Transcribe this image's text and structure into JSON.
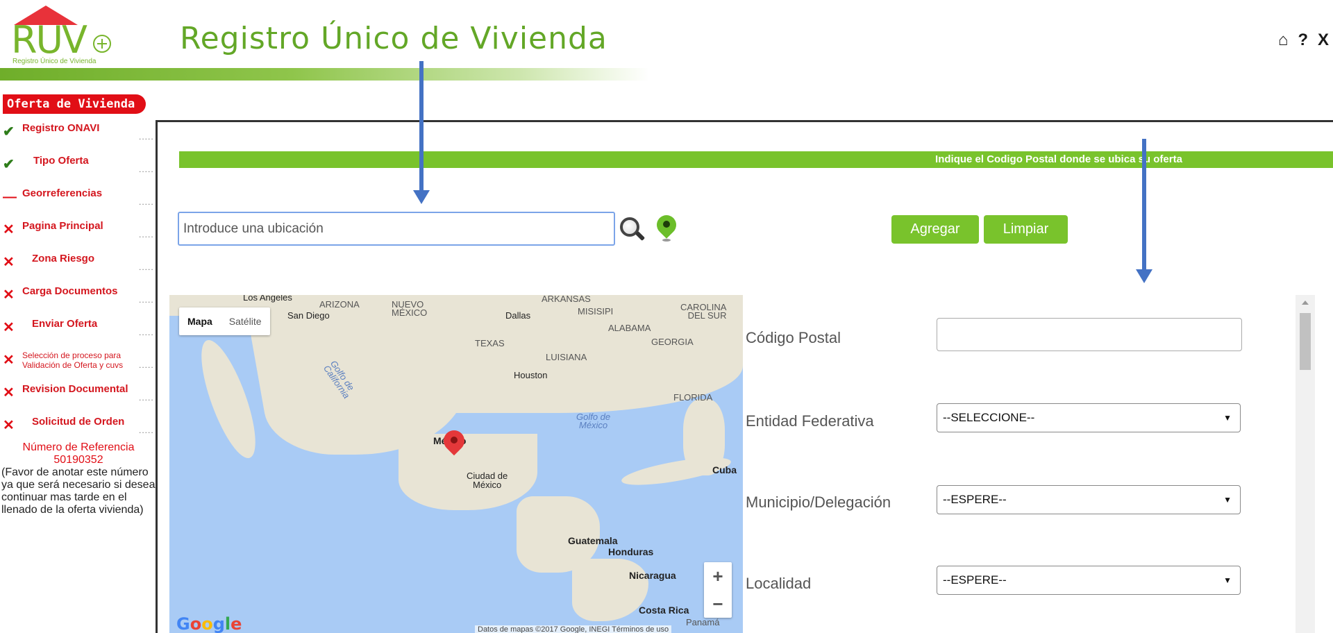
{
  "logo": {
    "text": "RUV",
    "subtitle": "Registro Único de Vivienda"
  },
  "header": {
    "title": "Registro Único de Vivienda"
  },
  "top_icons": [
    {
      "name": "home-icon",
      "glyph": "⌂"
    },
    {
      "name": "help-icon",
      "glyph": "?"
    },
    {
      "name": "close-icon",
      "glyph": "X"
    }
  ],
  "sidebar": {
    "title": "Oferta de Vivienda",
    "items": [
      {
        "status": "done",
        "icon": "✔",
        "label": "Registro ONAVI"
      },
      {
        "status": "done",
        "icon": "✔",
        "label": "Tipo Oferta"
      },
      {
        "status": "current",
        "icon": "—",
        "label": "Georreferencias"
      },
      {
        "status": "pending",
        "icon": "✕",
        "label": "Pagina Principal"
      },
      {
        "status": "pending",
        "icon": "✕",
        "label": "Zona Riesgo"
      },
      {
        "status": "pending",
        "icon": "✕",
        "label": "Carga Documentos"
      },
      {
        "status": "pending",
        "icon": "✕",
        "label": "Enviar Oferta"
      },
      {
        "status": "pending",
        "icon": "✕",
        "label": "Selección de proceso para Validación de Oferta y cuvs"
      },
      {
        "status": "pending",
        "icon": "✕",
        "label": "Revision Documental"
      },
      {
        "status": "pending",
        "icon": "✕",
        "label": "Solicitud de Orden"
      }
    ],
    "reference_label": "Número de Referencia",
    "reference_number": "50190352",
    "reference_note": "(Favor de anotar este número ya que será necesario si desea continuar mas tarde en el llenado de la oferta vivienda)"
  },
  "banner": "Indique el Codigo Postal donde se ubica su oferta",
  "search": {
    "placeholder": "Introduce una ubicación",
    "value": ""
  },
  "buttons": {
    "agregar": "Agregar",
    "limpiar": "Limpiar"
  },
  "map": {
    "type_buttons": [
      "Mapa",
      "Satélite"
    ],
    "labels": [
      {
        "text": "Los Angeles",
        "style": "dark"
      },
      {
        "text": "San Diego",
        "style": "dark"
      },
      {
        "text": "ARIZONA",
        "style": ""
      },
      {
        "text": "NUEVO\nMÉXICO",
        "style": ""
      },
      {
        "text": "ARKANSAS",
        "style": ""
      },
      {
        "text": "MISISIPI",
        "style": ""
      },
      {
        "text": "CAROLINA\nDEL SUR",
        "style": ""
      },
      {
        "text": "Dallas",
        "style": "dark"
      },
      {
        "text": "ALABAMA",
        "style": ""
      },
      {
        "text": "GEORGIA",
        "style": ""
      },
      {
        "text": "TEXAS",
        "style": ""
      },
      {
        "text": "LUISIANA",
        "style": ""
      },
      {
        "text": "Houston",
        "style": "dark"
      },
      {
        "text": "FLORIDA",
        "style": ""
      },
      {
        "text": "Golfo de\nCalifornia",
        "style": "sea"
      },
      {
        "text": "Golfo de\nMéxico",
        "style": "sea"
      },
      {
        "text": "México",
        "style": "big"
      },
      {
        "text": "Cuba",
        "style": "big"
      },
      {
        "text": "Ciudad de\nMéxico",
        "style": "dark"
      },
      {
        "text": "Guatemala",
        "style": "big"
      },
      {
        "text": "Honduras",
        "style": "big"
      },
      {
        "text": "Nicaragua",
        "style": "big"
      },
      {
        "text": "Costa Rica",
        "style": "big"
      },
      {
        "text": "Panamá",
        "style": ""
      }
    ],
    "logo_letters": [
      "G",
      "o",
      "o",
      "g",
      "l",
      "e"
    ],
    "attribution": "Datos de mapas ©2017 Google, INEGI   Términos de uso",
    "zoom_in": "+",
    "zoom_out": "−"
  },
  "form": {
    "codigo_postal": {
      "label": "Código Postal",
      "value": ""
    },
    "entidad": {
      "label": "Entidad Federativa",
      "value": "--SELECCIONE--"
    },
    "municipio": {
      "label": "Municipio/Delegación",
      "value": "--ESPERE--"
    },
    "localidad": {
      "label": "Localidad",
      "value": "--ESPERE--"
    }
  }
}
